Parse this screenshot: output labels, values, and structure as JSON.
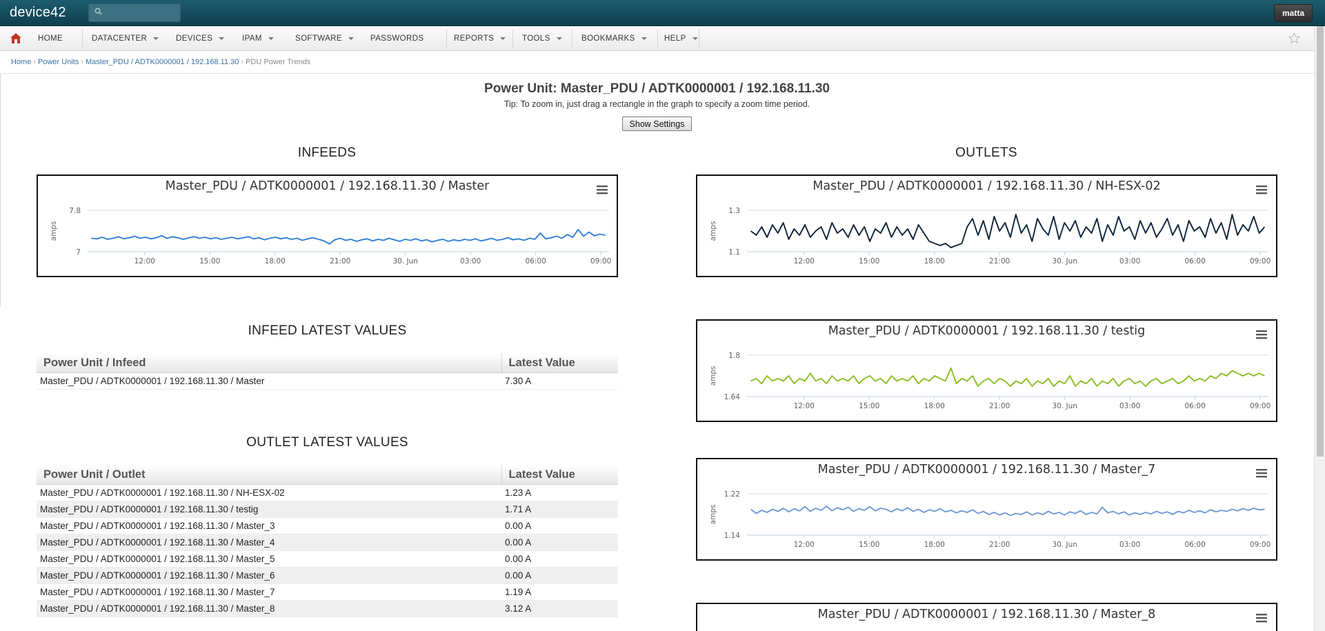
{
  "app": {
    "logo": "device42",
    "user": "matta",
    "search": {
      "value": "",
      "placeholder": ""
    }
  },
  "nav": {
    "items": [
      {
        "label": "HOME",
        "has_menu": false
      },
      {
        "label": "DATACENTER",
        "has_menu": true
      },
      {
        "label": "DEVICES",
        "has_menu": true
      },
      {
        "label": "IPAM",
        "has_menu": true
      },
      {
        "label": "SOFTWARE",
        "has_menu": true
      },
      {
        "label": "PASSWORDS",
        "has_menu": false
      },
      {
        "label": "REPORTS",
        "has_menu": true
      },
      {
        "label": "TOOLS",
        "has_menu": true
      },
      {
        "label": "BOOKMARKS",
        "has_menu": true
      },
      {
        "label": "HELP",
        "has_menu": true
      }
    ]
  },
  "breadcrumb": {
    "home": "Home",
    "power_units": "Power Units",
    "unit": "Master_PDU / ADTK0000001 / 192.168.11.30",
    "current": "PDU Power Trends"
  },
  "page": {
    "title": "Power Unit: Master_PDU / ADTK0000001 / 192.168.11.30",
    "tip": "Tip: To zoom in, just drag a rectangle in the graph to specify a zoom time period.",
    "settings_button": "Show Settings",
    "infeeds_heading": "INFEEDS",
    "outlets_heading": "OUTLETS",
    "infeed_latest_heading": "INFEED LATEST VALUES",
    "outlet_latest_heading": "OUTLET LATEST VALUES"
  },
  "infeed_table": {
    "headers": [
      "Power Unit / Infeed",
      "Latest Value"
    ],
    "rows": [
      [
        "Master_PDU / ADTK0000001 / 192.168.11.30 / Master",
        "7.30 A"
      ]
    ]
  },
  "outlet_table": {
    "headers": [
      "Power Unit / Outlet",
      "Latest Value"
    ],
    "rows": [
      [
        "Master_PDU / ADTK0000001 / 192.168.11.30 / NH-ESX-02",
        "1.23 A"
      ],
      [
        "Master_PDU / ADTK0000001 / 192.168.11.30 / testig",
        "1.71 A"
      ],
      [
        "Master_PDU / ADTK0000001 / 192.168.11.30 / Master_3",
        "0.00 A"
      ],
      [
        "Master_PDU / ADTK0000001 / 192.168.11.30 / Master_4",
        "0.00 A"
      ],
      [
        "Master_PDU / ADTK0000001 / 192.168.11.30 / Master_5",
        "0.00 A"
      ],
      [
        "Master_PDU / ADTK0000001 / 192.168.11.30 / Master_6",
        "0.00 A"
      ],
      [
        "Master_PDU / ADTK0000001 / 192.168.11.30 / Master_7",
        "1.19 A"
      ],
      [
        "Master_PDU / ADTK0000001 / 192.168.11.30 / Master_8",
        "3.12 A"
      ]
    ]
  },
  "colors": {
    "topbar": "#154c5c",
    "link": "#3a72a6",
    "series_infeed": "#2f7ed8",
    "series_nh": "#0d233a",
    "series_testig": "#8bbc21",
    "series_master7": "#6f9ad6"
  },
  "chart_data": [
    {
      "type": "line",
      "title": "Master_PDU / ADTK0000001 / 192.168.11.30 / Master",
      "ylabel": "amps",
      "yticks": [
        "7.8",
        "7"
      ],
      "ytick_values": [
        7.8,
        7.0
      ],
      "ylim": [
        7.0,
        7.8
      ],
      "xticks": [
        "12:00",
        "15:00",
        "18:00",
        "21:00",
        "30. Jun",
        "03:00",
        "06:00",
        "09:00"
      ],
      "xlim": [
        "29 Jun 09:30",
        "30 Jun 09:15"
      ],
      "color": "#2f7ed8",
      "values": [
        7.26,
        7.25,
        7.28,
        7.24,
        7.26,
        7.29,
        7.25,
        7.27,
        7.3,
        7.26,
        7.28,
        7.25,
        7.27,
        7.31,
        7.26,
        7.29,
        7.27,
        7.24,
        7.27,
        7.29,
        7.26,
        7.28,
        7.25,
        7.27,
        7.24,
        7.26,
        7.28,
        7.25,
        7.27,
        7.29,
        7.25,
        7.27,
        7.23,
        7.26,
        7.28,
        7.25,
        7.27,
        7.24,
        7.26,
        7.22,
        7.25,
        7.27,
        7.24,
        7.21,
        7.15,
        7.23,
        7.26,
        7.22,
        7.24,
        7.2,
        7.23,
        7.25,
        7.21,
        7.24,
        7.22,
        7.26,
        7.23,
        7.2,
        7.24,
        7.22,
        7.25,
        7.21,
        7.23,
        7.19,
        7.22,
        7.24,
        7.2,
        7.23,
        7.21,
        7.24,
        7.22,
        7.25,
        7.21,
        7.23,
        7.26,
        7.22,
        7.24,
        7.27,
        7.23,
        7.25,
        7.22,
        7.26,
        7.24,
        7.36,
        7.25,
        7.27,
        7.3,
        7.26,
        7.33,
        7.28,
        7.43,
        7.3,
        7.38,
        7.31,
        7.34,
        7.32
      ]
    },
    {
      "type": "line",
      "title": "Master_PDU / ADTK0000001 / 192.168.11.30 / NH-ESX-02",
      "ylabel": "amps",
      "yticks": [
        "1.3",
        "1.1"
      ],
      "ytick_values": [
        1.3,
        1.1
      ],
      "ylim": [
        1.1,
        1.3
      ],
      "xticks": [
        "12:00",
        "15:00",
        "18:00",
        "21:00",
        "30. Jun",
        "03:00",
        "06:00",
        "09:00"
      ],
      "xlim": [
        "29 Jun 09:30",
        "30 Jun 09:15"
      ],
      "color": "#0d233a",
      "values": [
        1.2,
        1.18,
        1.22,
        1.17,
        1.23,
        1.19,
        1.24,
        1.16,
        1.21,
        1.18,
        1.23,
        1.17,
        1.2,
        1.22,
        1.16,
        1.24,
        1.19,
        1.21,
        1.17,
        1.23,
        1.18,
        1.22,
        1.15,
        1.21,
        1.19,
        1.24,
        1.17,
        1.22,
        1.18,
        1.21,
        1.16,
        1.23,
        1.19,
        1.15,
        1.14,
        1.13,
        1.14,
        1.12,
        1.13,
        1.14,
        1.22,
        1.26,
        1.18,
        1.25,
        1.16,
        1.27,
        1.2,
        1.24,
        1.17,
        1.28,
        1.19,
        1.23,
        1.15,
        1.26,
        1.21,
        1.18,
        1.27,
        1.16,
        1.24,
        1.2,
        1.25,
        1.17,
        1.22,
        1.19,
        1.26,
        1.15,
        1.23,
        1.18,
        1.27,
        1.2,
        1.22,
        1.16,
        1.25,
        1.19,
        1.24,
        1.17,
        1.21,
        1.26,
        1.18,
        1.23,
        1.15,
        1.25,
        1.2,
        1.22,
        1.17,
        1.26,
        1.19,
        1.24,
        1.16,
        1.28,
        1.18,
        1.23,
        1.2,
        1.27,
        1.19,
        1.22
      ]
    },
    {
      "type": "line",
      "title": "Master_PDU / ADTK0000001 / 192.168.11.30 / testig",
      "ylabel": "amps",
      "yticks": [
        "1.8",
        "1.64"
      ],
      "ytick_values": [
        1.8,
        1.64
      ],
      "ylim": [
        1.64,
        1.8
      ],
      "xticks": [
        "12:00",
        "15:00",
        "18:00",
        "21:00",
        "30. Jun",
        "03:00",
        "06:00",
        "09:00"
      ],
      "xlim": [
        "29 Jun 09:30",
        "30 Jun 09:15"
      ],
      "color": "#8bbc21",
      "values": [
        1.7,
        1.71,
        1.69,
        1.72,
        1.7,
        1.71,
        1.7,
        1.72,
        1.69,
        1.71,
        1.7,
        1.73,
        1.7,
        1.71,
        1.69,
        1.72,
        1.7,
        1.71,
        1.7,
        1.72,
        1.69,
        1.71,
        1.72,
        1.7,
        1.71,
        1.69,
        1.72,
        1.7,
        1.71,
        1.7,
        1.72,
        1.69,
        1.71,
        1.7,
        1.72,
        1.71,
        1.7,
        1.75,
        1.69,
        1.71,
        1.7,
        1.72,
        1.68,
        1.7,
        1.71,
        1.69,
        1.71,
        1.7,
        1.68,
        1.7,
        1.69,
        1.71,
        1.68,
        1.7,
        1.69,
        1.71,
        1.68,
        1.7,
        1.69,
        1.72,
        1.68,
        1.7,
        1.69,
        1.71,
        1.68,
        1.7,
        1.69,
        1.71,
        1.68,
        1.7,
        1.71,
        1.69,
        1.7,
        1.68,
        1.7,
        1.71,
        1.69,
        1.7,
        1.71,
        1.69,
        1.7,
        1.72,
        1.7,
        1.71,
        1.7,
        1.72,
        1.71,
        1.73,
        1.72,
        1.74,
        1.73,
        1.72,
        1.73,
        1.72,
        1.73,
        1.72
      ]
    },
    {
      "type": "line",
      "title": "Master_PDU / ADTK0000001 / 192.168.11.30 / Master_7",
      "ylabel": "amps",
      "yticks": [
        "1.22",
        "1.14"
      ],
      "ytick_values": [
        1.22,
        1.14
      ],
      "ylim": [
        1.14,
        1.22
      ],
      "xticks": [
        "12:00",
        "15:00",
        "18:00",
        "21:00",
        "30. Jun",
        "03:00",
        "06:00",
        "09:00"
      ],
      "xlim": [
        "29 Jun 09:30",
        "30 Jun 09:15"
      ],
      "color": "#6f9ad6",
      "values": [
        1.19,
        1.182,
        1.188,
        1.184,
        1.19,
        1.186,
        1.192,
        1.185,
        1.191,
        1.187,
        1.195,
        1.186,
        1.192,
        1.188,
        1.196,
        1.187,
        1.193,
        1.189,
        1.194,
        1.186,
        1.191,
        1.188,
        1.195,
        1.187,
        1.192,
        1.19,
        1.185,
        1.191,
        1.187,
        1.193,
        1.186,
        1.19,
        1.184,
        1.189,
        1.186,
        1.191,
        1.185,
        1.188,
        1.183,
        1.187,
        1.184,
        1.189,
        1.182,
        1.186,
        1.18,
        1.184,
        1.179,
        1.183,
        1.178,
        1.182,
        1.18,
        1.185,
        1.179,
        1.183,
        1.18,
        1.186,
        1.181,
        1.184,
        1.179,
        1.185,
        1.182,
        1.187,
        1.18,
        1.184,
        1.181,
        1.194,
        1.183,
        1.186,
        1.181,
        1.185,
        1.179,
        1.183,
        1.18,
        1.184,
        1.181,
        1.186,
        1.182,
        1.185,
        1.18,
        1.186,
        1.183,
        1.188,
        1.184,
        1.187,
        1.183,
        1.189,
        1.185,
        1.188,
        1.186,
        1.19,
        1.187,
        1.191,
        1.188,
        1.192,
        1.189,
        1.19
      ]
    },
    {
      "type": "line",
      "title": "Master_PDU / ADTK0000001 / 192.168.11.30 / Master_8"
    }
  ]
}
